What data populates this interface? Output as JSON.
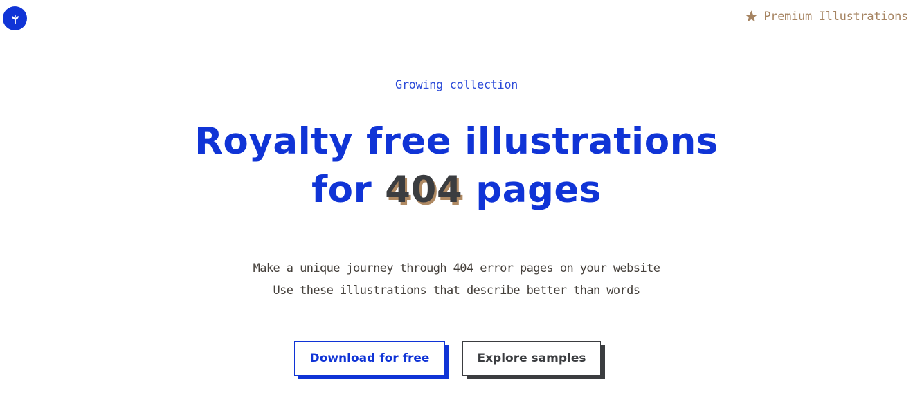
{
  "header": {
    "logo_icon": "sprout-icon",
    "premium_link": {
      "icon": "star-icon",
      "label": "Premium Illustrations"
    }
  },
  "hero": {
    "eyebrow": "Growing collection",
    "headline_line1": "Royalty free illustrations",
    "headline_line2_before": "for ",
    "headline_line2_number": "404",
    "headline_line2_after": " pages",
    "description_line1": "Make a unique journey through 404 error pages on your website",
    "description_line2": "Use these illustrations that describe better than words"
  },
  "actions": {
    "download_label": "Download for free",
    "explore_label": "Explore samples"
  },
  "colors": {
    "brand_blue": "#1034d6",
    "accent_tan": "#a68462",
    "text_dark": "#3b3d40",
    "background": "#ffffff"
  }
}
